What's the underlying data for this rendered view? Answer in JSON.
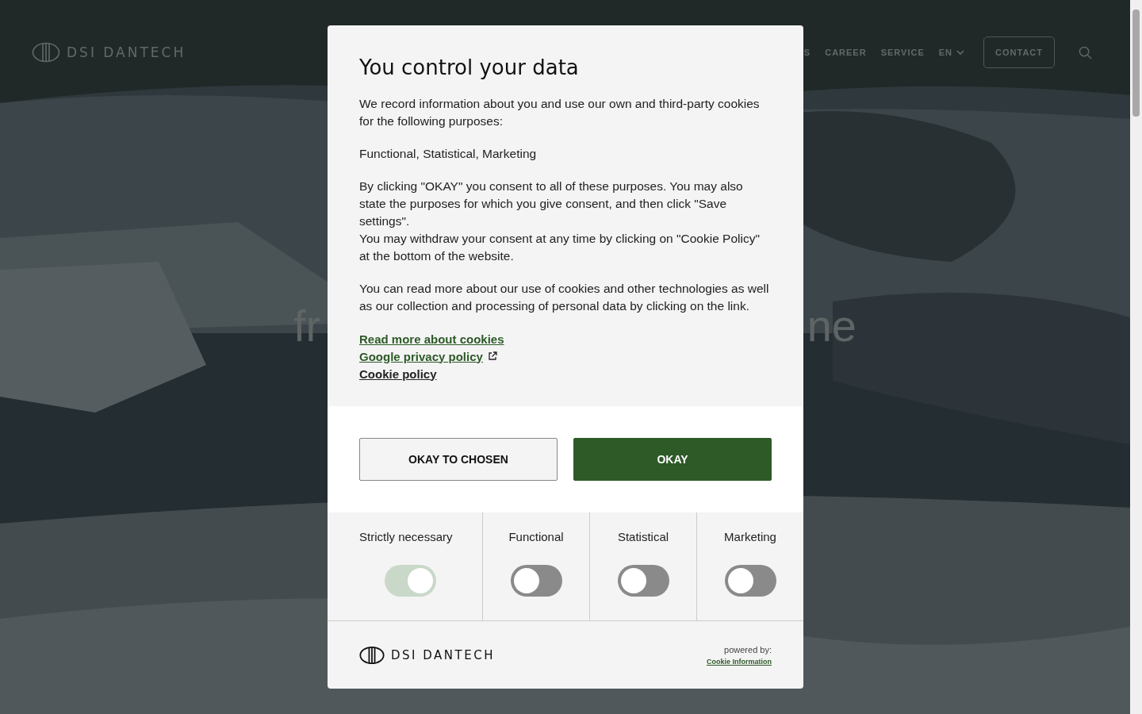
{
  "header": {
    "logo": "DSI DANTECH",
    "nav": [
      "S",
      "CAREER",
      "SERVICE"
    ],
    "language": "EN",
    "contact": "CONTACT"
  },
  "hero": {
    "fragments": [
      "fr",
      "ne"
    ]
  },
  "dialog": {
    "title": "You control your data",
    "paragraphs": [
      "We record information about you and use our own and third-party cookies for the following purposes:",
      "Functional, Statistical, Marketing",
      "By clicking \"OKAY\" you consent to all of these purposes. You may also state the purposes for which you give consent, and then click \"Save settings\".\nYou may withdraw your consent at any time by clicking on \"Cookie Policy\" at the bottom of the website.",
      "You can read more about our use of cookies and other technologies as well as our collection and processing of personal data by clicking on the link."
    ],
    "links": [
      {
        "label": "Read more about cookies",
        "external": false,
        "color": "#2d5a27"
      },
      {
        "label": "Google privacy policy",
        "external": true,
        "color": "#2d5a27"
      },
      {
        "label": "Cookie policy",
        "external": false,
        "color": "#222222"
      }
    ],
    "buttons": [
      {
        "label": "OKAY TO CHOSEN",
        "kind": "secondary"
      },
      {
        "label": "OKAY",
        "kind": "primary"
      }
    ],
    "categories": [
      {
        "label": "Strictly necessary",
        "checked": true,
        "disabled": true
      },
      {
        "label": "Functional",
        "checked": false,
        "disabled": false
      },
      {
        "label": "Statistical",
        "checked": false,
        "disabled": false
      },
      {
        "label": "Marketing",
        "checked": false,
        "disabled": false
      }
    ],
    "footer": {
      "logo": "DSI DANTECH",
      "powered_by": "powered by:",
      "provider": "Cookie Information"
    }
  }
}
